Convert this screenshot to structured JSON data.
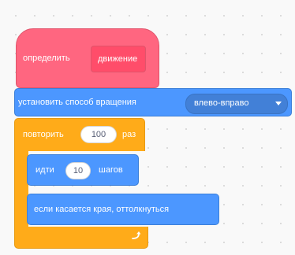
{
  "define_block": {
    "label": "определить",
    "name": "движение"
  },
  "rotation_block": {
    "label": "установить способ вращения",
    "value": "влево-вправо"
  },
  "repeat_block": {
    "label": "повторить",
    "count": "100",
    "suffix": "раз"
  },
  "move_block": {
    "label": "идти",
    "steps": "10",
    "suffix": "шагов"
  },
  "bounce_block": {
    "label": "если касается края, оттолкнуться"
  },
  "colors": {
    "events_pink": "#ff6680",
    "motion_blue": "#4c97ff",
    "control_orange": "#ffab19"
  },
  "icons": [
    "dropdown-caret-icon",
    "loop-arrow-icon"
  ]
}
